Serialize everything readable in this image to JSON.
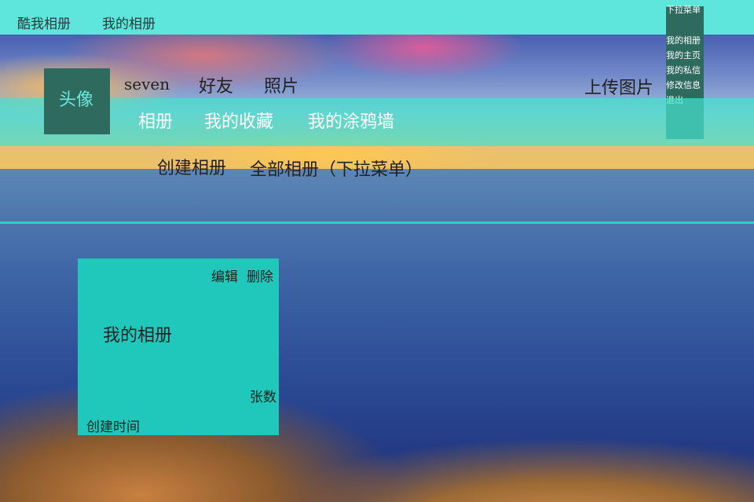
{
  "topbar": {
    "brand": "酷我相册",
    "my_album_link": "我的相册"
  },
  "dropdown": {
    "title": "下拉菜单",
    "items": [
      "我的相册",
      "我的主页",
      "我的私信",
      "修改信息",
      "退出"
    ]
  },
  "profile": {
    "avatar_label": "头像",
    "username": "seven",
    "friends": "好友",
    "photos": "照片",
    "upload": "上传图片"
  },
  "nav": {
    "albums": "相册",
    "favorites": "我的收藏",
    "graffiti_wall": "我的涂鸦墙"
  },
  "album_actions": {
    "create": "创建相册",
    "all_albums": "全部相册（下拉菜单）"
  },
  "album_card": {
    "edit": "编辑",
    "delete": "删除",
    "name": "我的相册",
    "count_label": "张数",
    "created_label": "创建时间"
  },
  "colors": {
    "topbar": "#5fe6dc",
    "panel_dark": "#2e6a5e",
    "nav_band": "#46e1cd",
    "card": "#20c8bc",
    "highlight_line": "#2ad0c0"
  }
}
